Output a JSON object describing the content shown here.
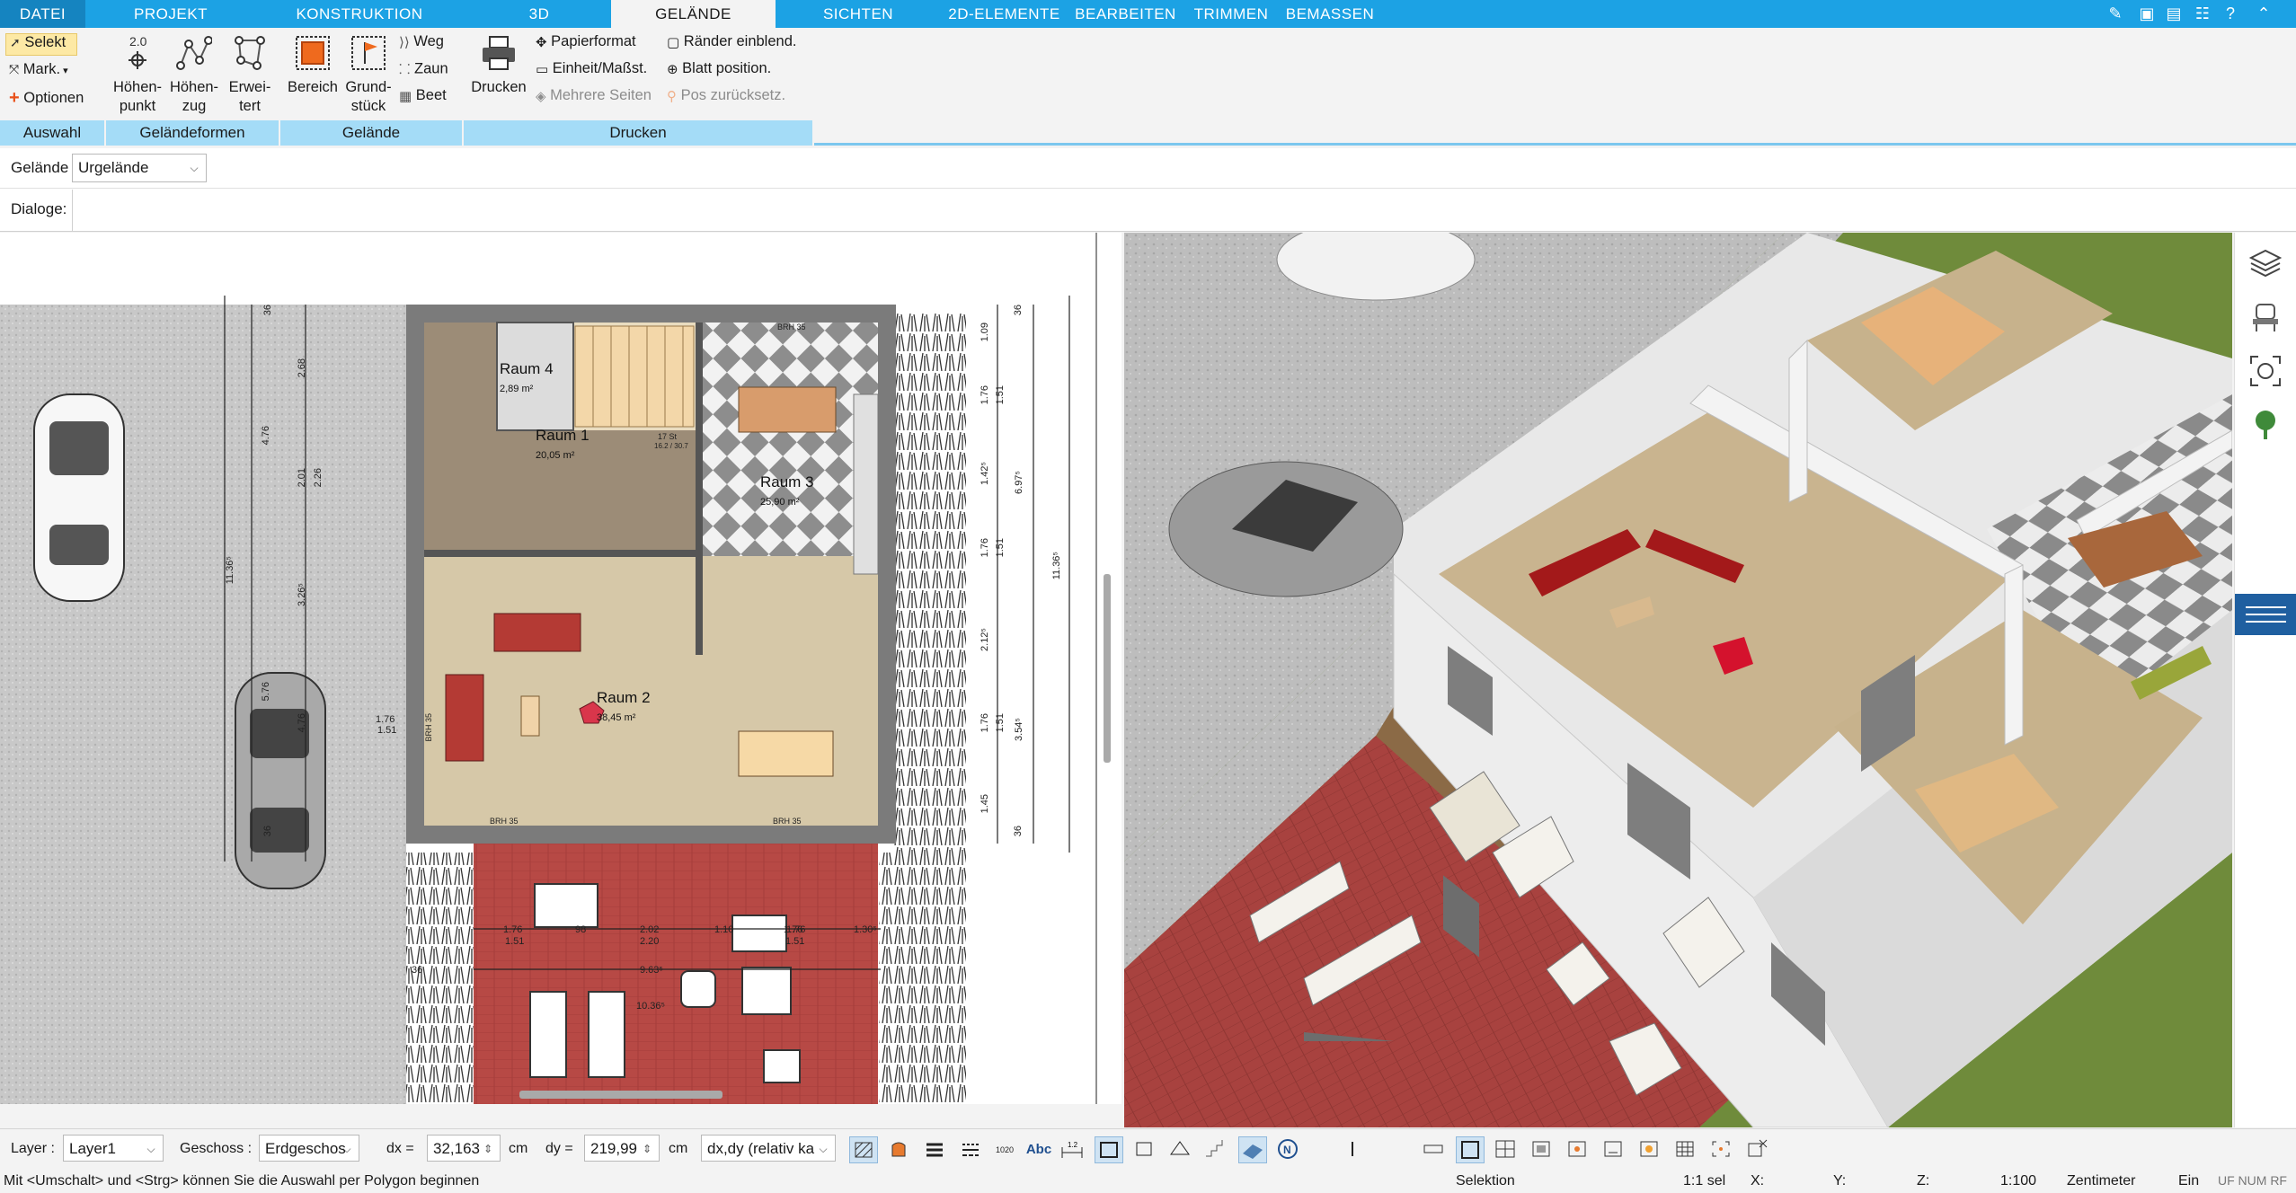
{
  "menu": {
    "tabs": [
      "DATEI",
      "PROJEKT",
      "KONSTRUKTION",
      "3D",
      "GELÄNDE",
      "SICHTEN",
      "2D-ELEMENTE",
      "BEARBEITEN",
      "TRIMMEN",
      "BEMASSEN"
    ],
    "active": "GELÄNDE"
  },
  "ribbon": {
    "auswahl": {
      "selekt": "Selekt",
      "mark": "Mark.",
      "optionen": "Optionen",
      "label": "Auswahl"
    },
    "gelaendeformen": {
      "hoehenpunkt": [
        "Höhen-",
        "punkt"
      ],
      "hoehenzug": [
        "Höhen-",
        "zug"
      ],
      "erweitert": [
        "Erwei-",
        "tert"
      ],
      "label": "Geländeformen"
    },
    "gelaende": {
      "bereich": "Bereich",
      "grundstueck": [
        "Grund-",
        "stück"
      ],
      "weg": "Weg",
      "zaun": "Zaun",
      "beet": "Beet",
      "label": "Gelände"
    },
    "drucken": {
      "drucken": "Drucken",
      "papierformat": "Papierformat",
      "einheit": "Einheit/Maßst.",
      "mehrere": "Mehrere Seiten",
      "raender": "Ränder einblend.",
      "blatt": "Blatt position.",
      "pos": "Pos zurücksetz.",
      "label": "Drucken"
    }
  },
  "options": {
    "gelaende_label": "Gelände",
    "gelaende_value": "Urgelände",
    "dialoge_label": "Dialoge:"
  },
  "plan": {
    "rooms": [
      {
        "name": "Raum 4",
        "area": "2,89 m²"
      },
      {
        "name": "Raum 1",
        "area": "20,05 m²"
      },
      {
        "name": "Raum 3",
        "area": "25,90 m²"
      },
      {
        "name": "Raum 2",
        "area": "38,45 m²"
      }
    ],
    "dims_right": [
      "36",
      "1.09",
      "1.76",
      "1.51",
      "1.42⁵",
      "6.97⁵",
      "1.76",
      "1.51",
      "2.12⁵",
      "11.36⁵",
      "1.76",
      "1.51",
      "3.54⁵",
      "1.45",
      "36"
    ],
    "dims_left": [
      "36",
      "2.68",
      "4.76",
      "2.01",
      "2.26",
      "11.36⁵",
      "3.26⁵",
      "5.76",
      "4.76",
      "36"
    ],
    "dims_bottom": [
      "1.76",
      "1.51",
      "98",
      "2.02",
      "2.20",
      "1.10",
      "1.76",
      "1.30⁵",
      "9.63⁵",
      "10.36⁵",
      "36"
    ],
    "misc": [
      "BRH 35",
      "BRH 35",
      "BRH 35",
      "BRH 35",
      "1.76",
      "1.51",
      "17 St",
      "16.2 / 30.7",
      "1.76",
      "1.51"
    ]
  },
  "sidebar": {
    "icons": [
      "layers-icon",
      "chair-icon",
      "focus-icon",
      "tree-icon",
      "hamburger-icon"
    ]
  },
  "status": {
    "layer_label": "Layer :",
    "layer_value": "Layer1",
    "geschoss_label": "Geschoss :",
    "geschoss_value": "Erdgeschos",
    "dx_label": "dx =",
    "dx_value": "32,163",
    "dx_unit": "cm",
    "dy_label": "dy =",
    "dy_value": "219,99",
    "dy_unit": "cm",
    "mode_value": "dx,dy (relativ ka",
    "abc": "Abc"
  },
  "msg": {
    "text": "Mit <Umschalt> und <Strg> können Sie die Auswahl per Polygon beginnen",
    "selektion": "Selektion",
    "sel": "1:1 sel",
    "x": "X:",
    "y": "Y:",
    "z": "Z:",
    "scale": "1:100",
    "unit": "Zentimeter",
    "ein": "Ein",
    "flags": "UF NUM RF"
  }
}
